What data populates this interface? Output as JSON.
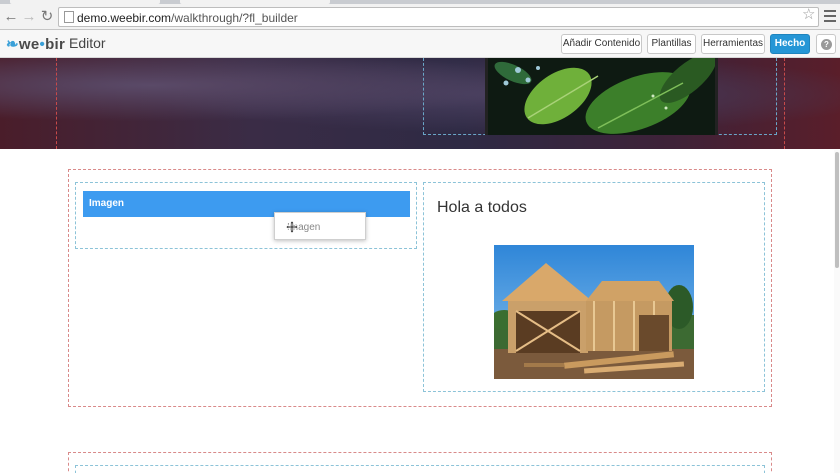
{
  "browser": {
    "url_host": "demo.weebir.com",
    "url_path": "/walkthrough/?fl_builder",
    "icons": {
      "back": "back-arrow-icon",
      "forward": "forward-arrow-icon",
      "reload": "reload-icon",
      "bookmark": "star-icon",
      "menu": "hamburger-menu-icon"
    }
  },
  "editor_bar": {
    "logo_text_a": "we",
    "logo_text_b": "bir",
    "title": "Editor",
    "buttons": {
      "add_content": "Añadir Contenido",
      "templates": "Plantillas",
      "tools": "Herramientas",
      "done": "Hecho"
    },
    "help_glyph": "?"
  },
  "content": {
    "module_label": "Imagen",
    "drag_label": "Imagen",
    "heading": "Hola a todos"
  },
  "colors": {
    "accent": "#2596d6",
    "module_bar": "#3d9bf0",
    "row_outline": "#d98a8a",
    "column_outline": "#8cc3d8"
  }
}
